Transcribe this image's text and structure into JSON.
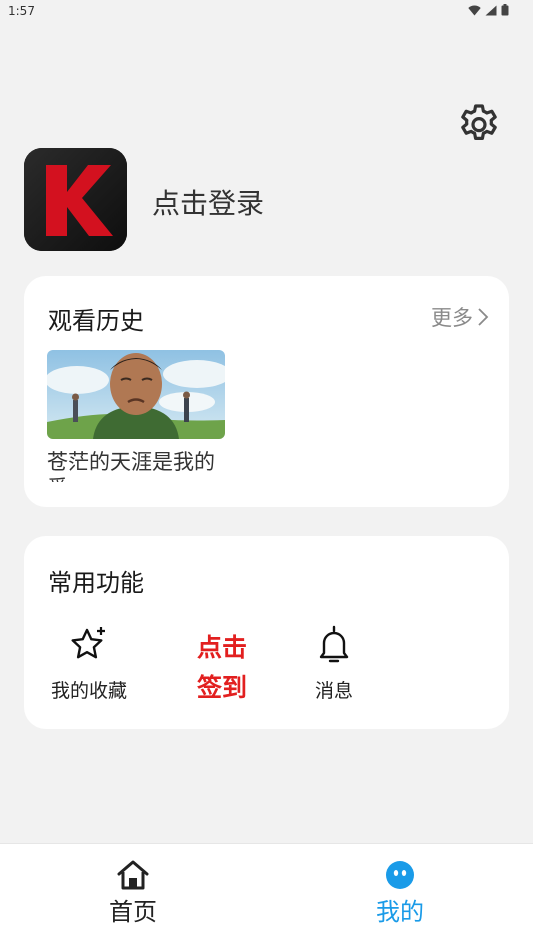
{
  "status_bar": {
    "time": "1:57"
  },
  "profile": {
    "login_label": "点击登录"
  },
  "history": {
    "title": "观看历史",
    "more_label": "更多",
    "items": [
      {
        "title": "苍茫的天涯是我的爱"
      }
    ]
  },
  "functions": {
    "title": "常用功能",
    "favorites_label": "我的收藏",
    "checkin_line1": "点击",
    "checkin_line2": "签到",
    "messages_label": "消息"
  },
  "bottom_nav": {
    "home_label": "首页",
    "mine_label": "我的",
    "active": "mine"
  },
  "colors": {
    "accent": "#1a9be8",
    "checkin": "#e21f1f",
    "logo_red": "#d3111f"
  },
  "icons": {
    "settings": "gear-icon",
    "more": "chevron-right-icon",
    "favorites": "star-icon",
    "messages": "bell-icon",
    "home": "home-icon",
    "mine": "face-icon"
  }
}
